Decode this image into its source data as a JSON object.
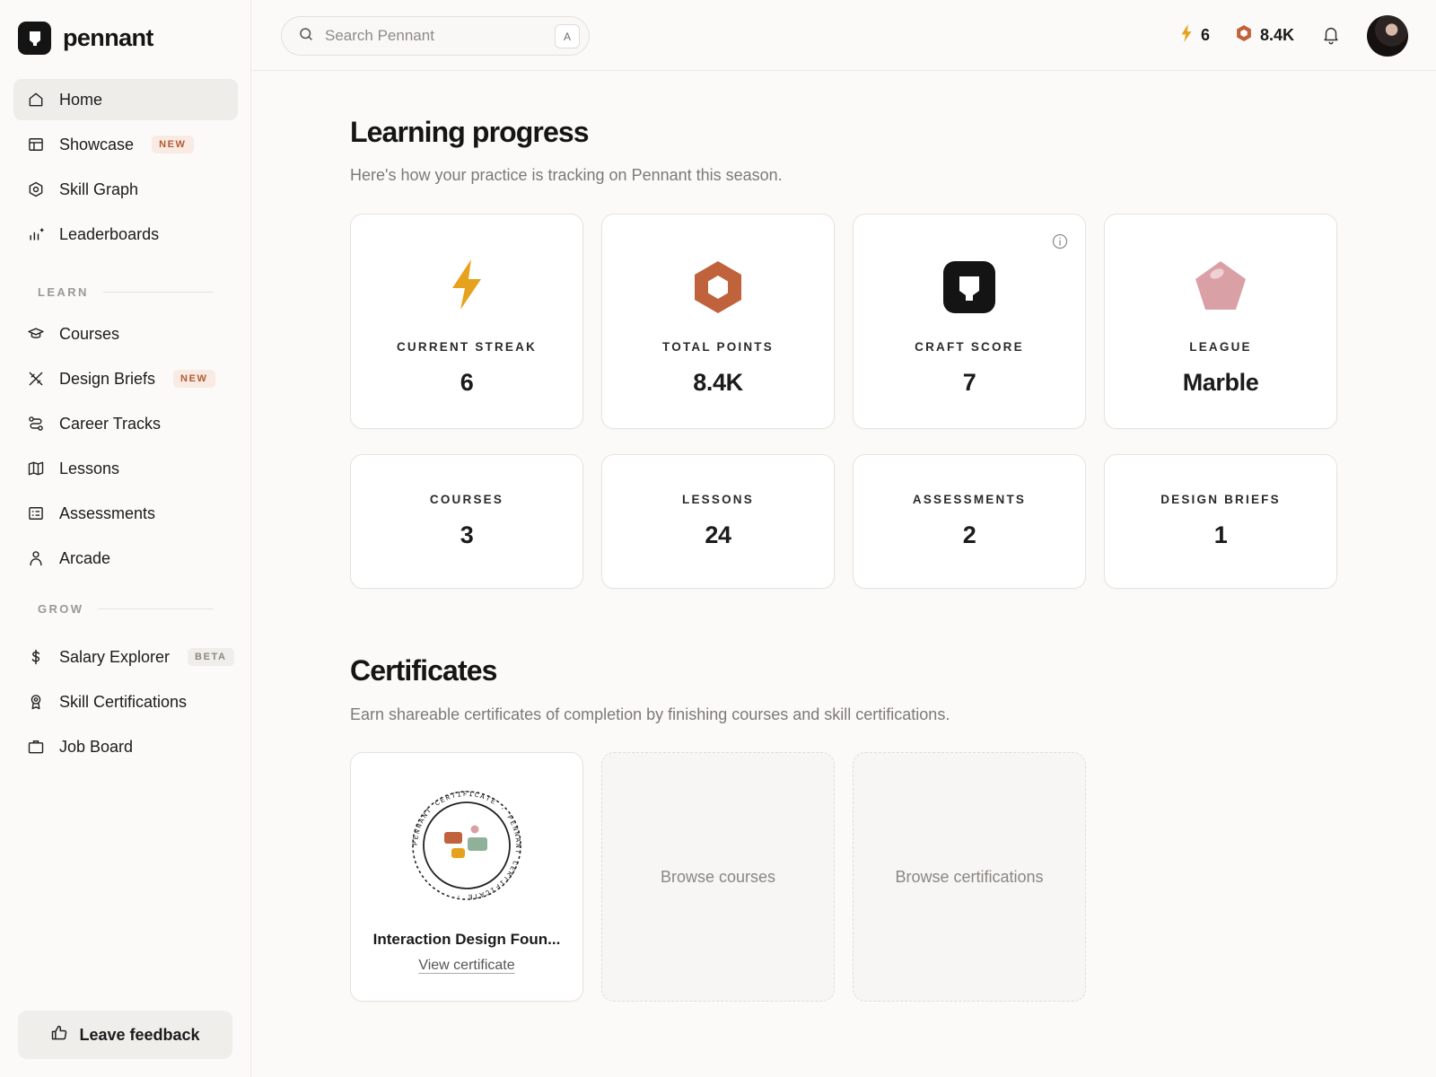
{
  "brand": {
    "name": "pennant"
  },
  "sidebar": {
    "main_items": [
      {
        "label": "Home",
        "icon": "home-icon",
        "active": true
      },
      {
        "label": "Showcase",
        "icon": "layout-icon",
        "badge": "NEW"
      },
      {
        "label": "Skill Graph",
        "icon": "hexagon-icon"
      },
      {
        "label": "Leaderboards",
        "icon": "bar-chart-icon"
      }
    ],
    "learn_heading": "LEARN",
    "learn_items": [
      {
        "label": "Courses",
        "icon": "graduation-cap-icon"
      },
      {
        "label": "Design Briefs",
        "icon": "tools-icon",
        "badge": "NEW"
      },
      {
        "label": "Career Tracks",
        "icon": "route-icon"
      },
      {
        "label": "Lessons",
        "icon": "map-icon"
      },
      {
        "label": "Assessments",
        "icon": "checklist-icon"
      },
      {
        "label": "Arcade",
        "icon": "person-icon"
      }
    ],
    "grow_heading": "GROW",
    "grow_items": [
      {
        "label": "Salary Explorer",
        "icon": "dollar-icon",
        "badge": "BETA"
      },
      {
        "label": "Skill Certifications",
        "icon": "award-icon"
      },
      {
        "label": "Job Board",
        "icon": "briefcase-icon"
      }
    ],
    "feedback_label": "Leave feedback"
  },
  "topbar": {
    "search_placeholder": "Search Pennant",
    "search_shortcut": "A",
    "streak": "6",
    "points": "8.4K"
  },
  "progress": {
    "title": "Learning progress",
    "subtitle": "Here's how your practice is tracking on Pennant this season.",
    "stats": [
      {
        "label": "CURRENT STREAK",
        "value": "6",
        "icon": "lightning-icon"
      },
      {
        "label": "TOTAL POINTS",
        "value": "8.4K",
        "icon": "hexagon-points-icon"
      },
      {
        "label": "CRAFT SCORE",
        "value": "7",
        "icon": "craft-badge-icon"
      },
      {
        "label": "LEAGUE",
        "value": "Marble",
        "icon": "pentagon-gem-icon"
      }
    ],
    "counts": [
      {
        "label": "COURSES",
        "value": "3"
      },
      {
        "label": "LESSONS",
        "value": "24"
      },
      {
        "label": "ASSESSMENTS",
        "value": "2"
      },
      {
        "label": "DESIGN BRIEFS",
        "value": "1"
      }
    ]
  },
  "certificates": {
    "title": "Certificates",
    "subtitle": "Earn shareable certificates of completion by finishing courses and skill certifications.",
    "earned": {
      "title": "Interaction Design Foun...",
      "link": "View certificate",
      "seal_text": "PENNANT CERTIFICATE · PENNANT CERTIFICATE ·"
    },
    "placeholders": [
      "Browse courses",
      "Browse certifications"
    ]
  },
  "colors": {
    "accent_orange": "#c0623b",
    "streak_yellow": "#e6a21c",
    "league_pink": "#d9a1a6",
    "dark": "#141414"
  }
}
